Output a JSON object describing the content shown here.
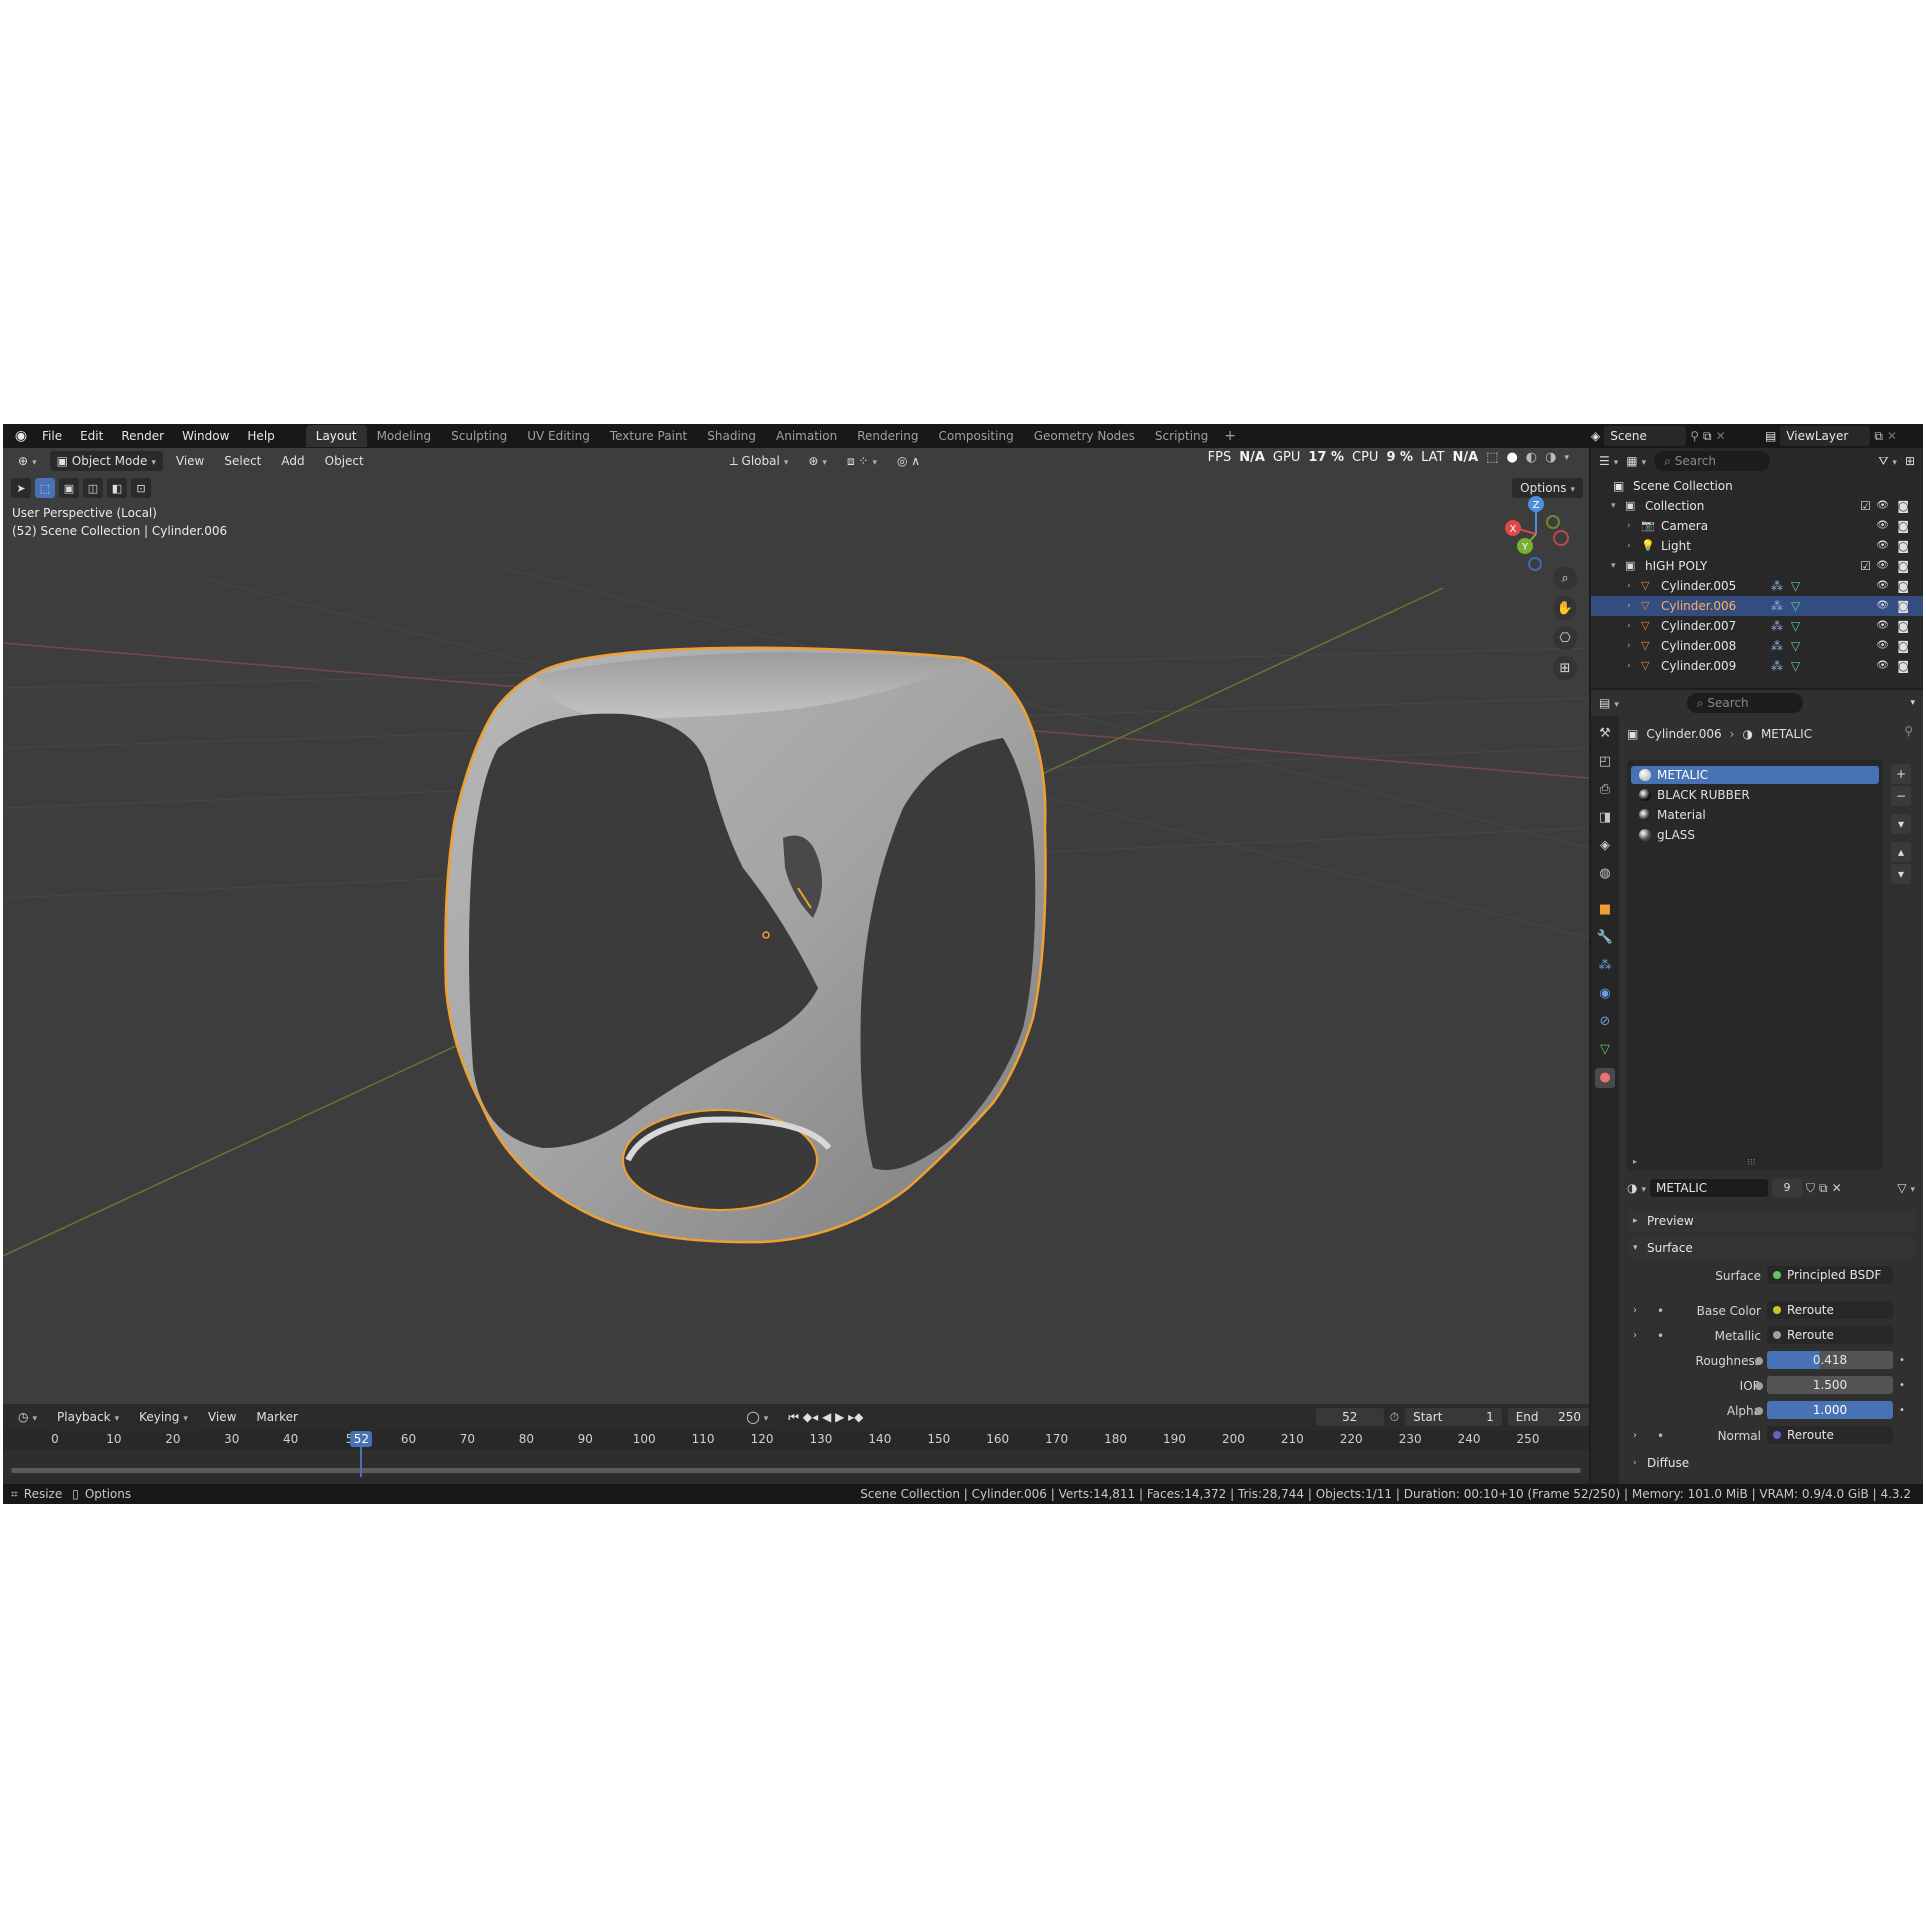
{
  "topbar": {
    "menus": [
      "File",
      "Edit",
      "Render",
      "Window",
      "Help"
    ],
    "workspaces": [
      "Layout",
      "Modeling",
      "Sculpting",
      "UV Editing",
      "Texture Paint",
      "Shading",
      "Animation",
      "Rendering",
      "Compositing",
      "Geometry Nodes",
      "Scripting"
    ],
    "active_workspace": "Layout",
    "scene_name": "Scene",
    "view_layer": "ViewLayer"
  },
  "viewport": {
    "mode": "Object Mode",
    "menus": [
      "View",
      "Select",
      "Add",
      "Object"
    ],
    "transform_orientation": "Global",
    "perspective_label": "User Perspective (Local)",
    "context_label": "(52) Scene Collection | Cylinder.006",
    "options_label": "Options",
    "stats": {
      "fps_label": "FPS",
      "fps_value": "N/A",
      "gpu_label": "GPU",
      "gpu_value": "17 %",
      "cpu_label": "CPU",
      "cpu_value": "9 %",
      "lat_label": "LAT",
      "lat_value": "N/A"
    },
    "gizmo": {
      "x": "X",
      "y": "Y",
      "z": "Z"
    },
    "colors": {
      "background": "#3d3d3d",
      "selection_outline": "#f0a030",
      "x_axis": "#a04848",
      "y_axis": "#6a8a30"
    }
  },
  "timeline": {
    "menus": [
      "Playback",
      "Keying",
      "View",
      "Marker"
    ],
    "current_frame": "52",
    "start_label": "Start",
    "start_value": "1",
    "end_label": "End",
    "end_value": "250",
    "ticks": [
      "0",
      "10",
      "20",
      "30",
      "40",
      "5",
      "60",
      "70",
      "80",
      "90",
      "100",
      "110",
      "120",
      "130",
      "140",
      "150",
      "160",
      "170",
      "180",
      "190",
      "200",
      "210",
      "220",
      "230",
      "240",
      "250"
    ]
  },
  "statusbar": {
    "left_items": [
      "Resize",
      "Options"
    ],
    "info": "Scene Collection | Cylinder.006 | Verts:14,811 | Faces:14,372 | Tris:28,744 | Objects:1/11 | Duration: 00:10+10 (Frame 52/250) | Memory: 101.0 MiB | VRAM: 0.9/4.0 GiB | 4.3.2"
  },
  "outliner": {
    "search_placeholder": "Search",
    "root": "Scene Collection",
    "rows": [
      {
        "label": "Collection",
        "type": "collection"
      },
      {
        "label": "Camera",
        "type": "camera"
      },
      {
        "label": "Light",
        "type": "light"
      },
      {
        "label": "hIGH POLY",
        "type": "collection"
      },
      {
        "label": "Cylinder.005",
        "type": "mesh"
      },
      {
        "label": "Cylinder.006",
        "type": "mesh",
        "selected": true
      },
      {
        "label": "Cylinder.007",
        "type": "mesh"
      },
      {
        "label": "Cylinder.008",
        "type": "mesh"
      },
      {
        "label": "Cylinder.009",
        "type": "mesh"
      }
    ]
  },
  "properties": {
    "search_placeholder": "Search",
    "breadcrumb_object": "Cylinder.006",
    "breadcrumb_material": "METALIC",
    "materials": [
      {
        "name": "METALIC",
        "color": "#c8c8c8",
        "selected": true
      },
      {
        "name": "BLACK RUBBER",
        "color": "#111111"
      },
      {
        "name": "Material",
        "color": "#222222"
      },
      {
        "name": "gLASS",
        "color": "#444444"
      }
    ],
    "material_name": "METALIC",
    "user_count": "9",
    "panels": {
      "preview": "Preview",
      "surface": "Surface",
      "diffuse": "Diffuse"
    },
    "surface_rows": {
      "surface_label": "Surface",
      "surface_value": "Principled BSDF",
      "base_color_label": "Base Color",
      "base_color_value": "Reroute",
      "metallic_label": "Metallic",
      "metallic_value": "Reroute",
      "roughness_label": "Roughness",
      "roughness_value": "0.418",
      "ior_label": "IOR",
      "ior_value": "1.500",
      "alpha_label": "Alpha",
      "alpha_value": "1.000",
      "normal_label": "Normal",
      "normal_value": "Reroute"
    },
    "colors": {
      "accent": "#4772b3",
      "shader_socket": "#63c763",
      "color_socket": "#c7c729",
      "float_socket": "#a1a1a1",
      "vector_socket": "#6363c7"
    }
  }
}
